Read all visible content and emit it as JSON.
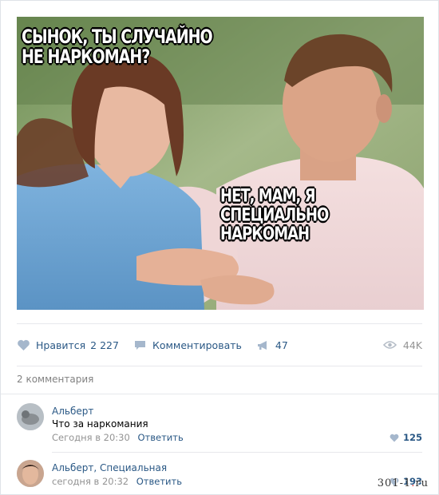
{
  "meme": {
    "caption_top_line1": "СЫНОК, ТЫ СЛУЧАЙНО",
    "caption_top_line2": "НЕ НАРКОМАН?",
    "caption_bottom_line1": "НЕТ, МАМ, Я СПЕЦИАЛЬНО",
    "caption_bottom_line2": "НАРКОМАН"
  },
  "actions": {
    "like_label": "Нравится",
    "like_count": "2 227",
    "comment_label": "Комментировать",
    "share_count": "47",
    "views_count": "44K"
  },
  "comments_header": "2 комментария",
  "comments": [
    {
      "author": "Альберт",
      "text": "Что за наркомания",
      "time": "Сегодня в 20:30",
      "reply": "Ответить",
      "likes": "125"
    },
    {
      "author": "Альберт, Специальная",
      "text": "",
      "time": "сегодня в 20:32",
      "reply": "Ответить",
      "likes": "193"
    }
  ],
  "watermark": {
    "prefix": "301-1",
    "dot": ".",
    "suffix": "ru"
  },
  "colors": {
    "link": "#2a5885",
    "muted": "#939393",
    "border": "#e7e8ec"
  },
  "icons": [
    "heart-icon",
    "comment-icon",
    "share-megaphone-icon",
    "eye-icon"
  ]
}
